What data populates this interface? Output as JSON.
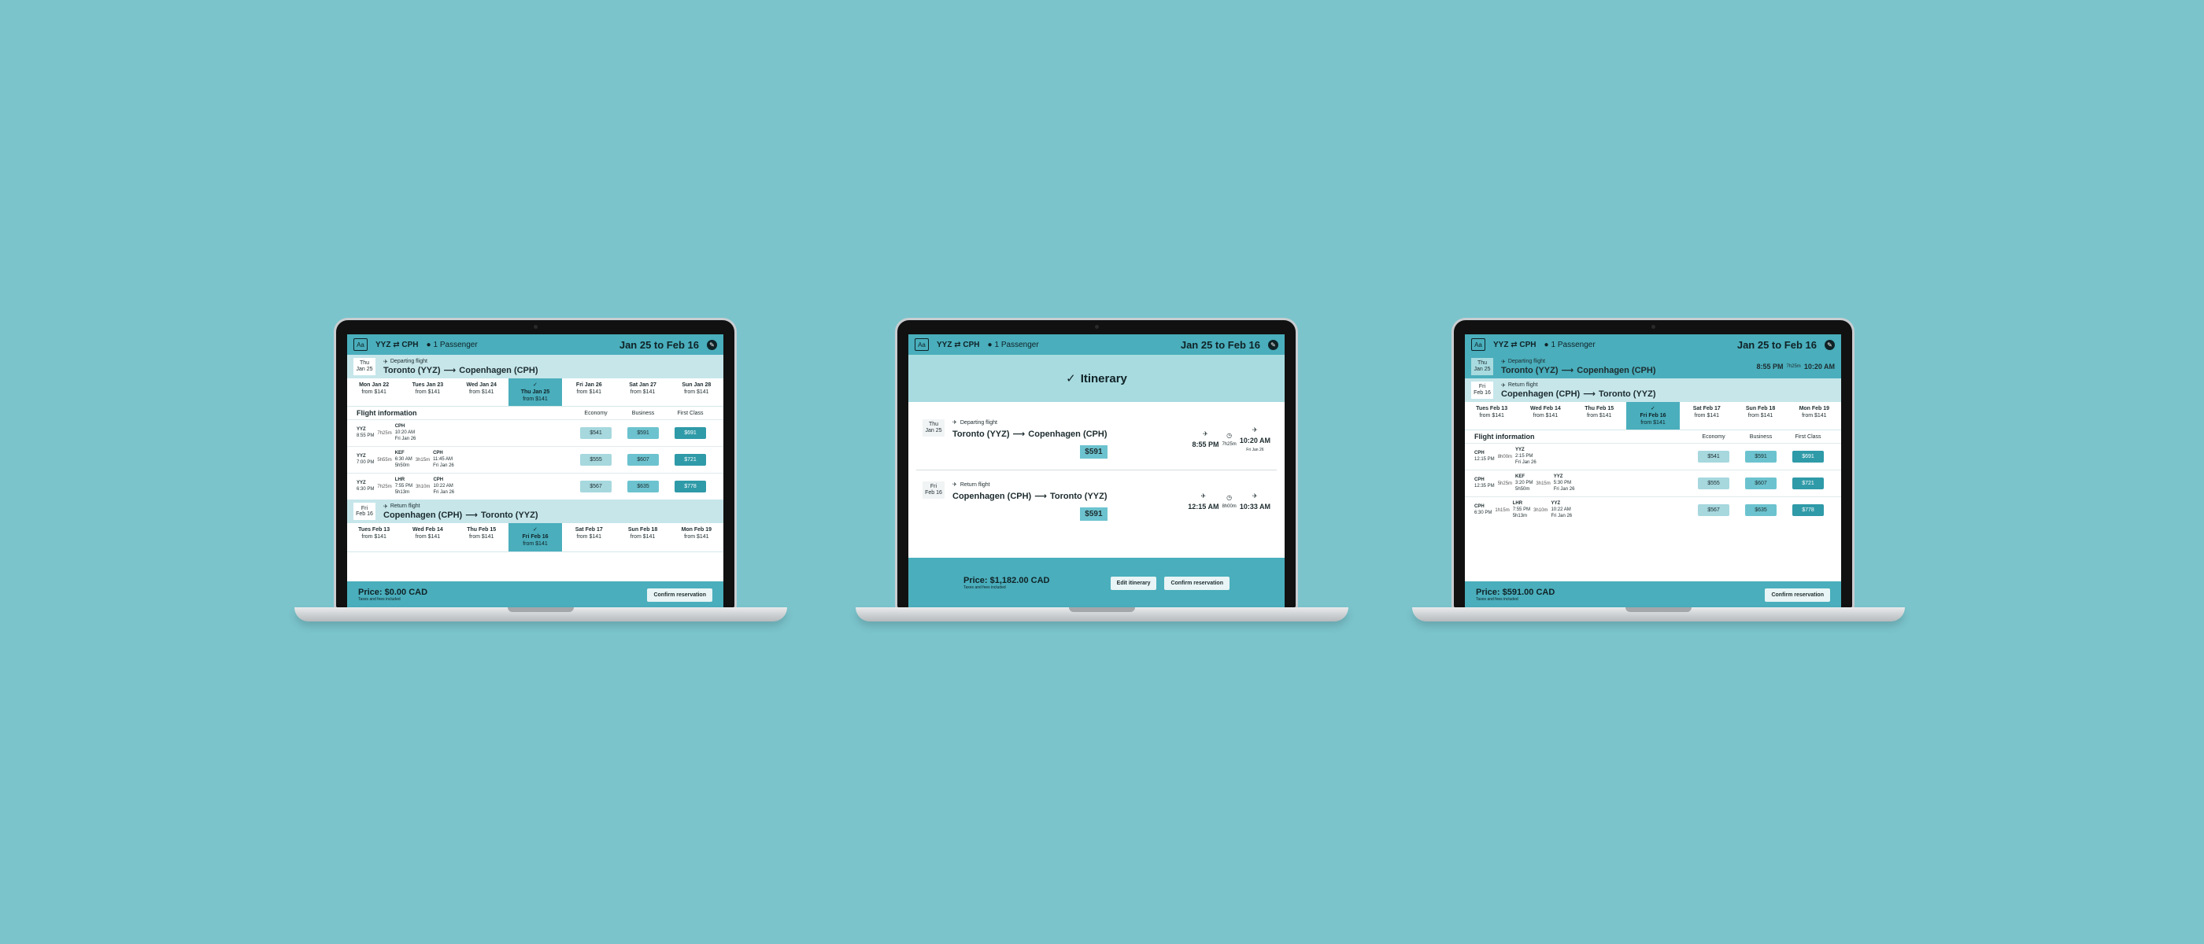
{
  "header": {
    "logo": "Aa",
    "route": "YYZ ⇄ CPH",
    "passengers": "1 Passenger",
    "dates": "Jan 25 to Feb 16"
  },
  "screen1": {
    "depart": {
      "day": "Thu\nJan 25",
      "label": "Departing flight",
      "from": "Toronto (YYZ)",
      "to": "Copenhagen (CPH)"
    },
    "depart_dates": [
      {
        "w": "Mon Jan 22",
        "p": "from $141"
      },
      {
        "w": "Tues Jan 23",
        "p": "from $141"
      },
      {
        "w": "Wed Jan 24",
        "p": "from $141"
      },
      {
        "w": "Thu Jan 25",
        "p": "from $141"
      },
      {
        "w": "Fri Jan 26",
        "p": "from $141"
      },
      {
        "w": "Sat Jan 27",
        "p": "from $141"
      },
      {
        "w": "Sun Jan 28",
        "p": "from $141"
      }
    ],
    "fi": {
      "title": "Flight information",
      "economy": "Economy",
      "business": "Business",
      "first": "First Class"
    },
    "flights": [
      {
        "segs": [
          [
            "YYZ",
            "8:55 PM"
          ],
          [
            "7h25m"
          ],
          [
            "CPH",
            "10:20 AM",
            "Fri Jan 26"
          ]
        ],
        "e": "$541",
        "b": "$591",
        "f": "$691"
      },
      {
        "segs": [
          [
            "YYZ",
            "7:00 PM"
          ],
          [
            "5h55m"
          ],
          [
            "KEF",
            "6:30 AM",
            "5h50m"
          ],
          [
            "3h15m"
          ],
          [
            "CPH",
            "11:45 AM",
            "Fri Jan 26"
          ]
        ],
        "e": "$555",
        "b": "$607",
        "f": "$721"
      },
      {
        "segs": [
          [
            "YYZ",
            "6:30 PM"
          ],
          [
            "7h25m"
          ],
          [
            "LHR",
            "7:55 PM",
            "5h13m"
          ],
          [
            "3h10m"
          ],
          [
            "CPH",
            "10:22 AM",
            "Fri Jan 26"
          ]
        ],
        "e": "$567",
        "b": "$635",
        "f": "$778"
      }
    ],
    "return": {
      "day": "Fri\nFeb 16",
      "label": "Return flight",
      "from": "Copenhagen (CPH)",
      "to": "Toronto (YYZ)"
    },
    "return_dates": [
      {
        "w": "Tues Feb 13",
        "p": "from $141"
      },
      {
        "w": "Wed Feb 14",
        "p": "from $141"
      },
      {
        "w": "Thu Feb 15",
        "p": "from $141"
      },
      {
        "w": "Fri Feb 16",
        "p": "from $141"
      },
      {
        "w": "Sat Feb 17",
        "p": "from $141"
      },
      {
        "w": "Sun Feb 18",
        "p": "from $141"
      },
      {
        "w": "Mon Feb 19",
        "p": "from $141"
      }
    ],
    "price": "Price: $0.00 CAD",
    "note": "Taxes and fees included",
    "confirm": "Confirm reservation"
  },
  "screen2": {
    "title": "Itinerary",
    "depart": {
      "day": "Thu\nJan 25",
      "label": "Departing flight",
      "from": "Toronto (YYZ)",
      "to": "Copenhagen (CPH)",
      "price": "$591",
      "dep": "8:55 PM",
      "dur": "7h25m",
      "arr": "10:20 AM",
      "arrdate": "Fri Jan 26"
    },
    "return": {
      "day": "Fri\nFeb 16",
      "label": "Return flight",
      "from": "Copenhagen (CPH)",
      "to": "Toronto (YYZ)",
      "price": "$591",
      "dep": "12:15 AM",
      "dur": "8h00m",
      "arr": "10:33 AM"
    },
    "price": "Price: $1,182.00 CAD",
    "note": "Taxes and fees included",
    "edit": "Edit itinerary",
    "confirm": "Confirm reservation"
  },
  "screen3": {
    "depart": {
      "day": "Thu\nJan 25",
      "label": "Departing flight",
      "from": "Toronto (YYZ)",
      "to": "Copenhagen (CPH)",
      "dep": "8:55 PM",
      "dur": "7h25m",
      "arr": "10:20 AM"
    },
    "return": {
      "day": "Fri\nFeb 16",
      "label": "Return flight",
      "from": "Copenhagen (CPH)",
      "to": "Toronto (YYZ)"
    },
    "return_dates": [
      {
        "w": "Tues Feb 13",
        "p": "from $141"
      },
      {
        "w": "Wed Feb 14",
        "p": "from $141"
      },
      {
        "w": "Thu Feb 15",
        "p": "from $141"
      },
      {
        "w": "Fri Feb 16",
        "p": "from $141"
      },
      {
        "w": "Sat Feb 17",
        "p": "from $141"
      },
      {
        "w": "Sun Feb 18",
        "p": "from $141"
      },
      {
        "w": "Mon Feb 19",
        "p": "from $141"
      }
    ],
    "fi": {
      "title": "Flight information",
      "economy": "Economy",
      "business": "Business",
      "first": "First Class"
    },
    "flights": [
      {
        "segs": [
          [
            "CPH",
            "12:15 PM"
          ],
          [
            "8h00m"
          ],
          [
            "YYZ",
            "2:15 PM",
            "Fri Jan 26"
          ]
        ],
        "e": "$541",
        "b": "$591",
        "f": "$691"
      },
      {
        "segs": [
          [
            "CPH",
            "12:35 PM"
          ],
          [
            "5h25m"
          ],
          [
            "KEF",
            "3:20 PM",
            "5h50m"
          ],
          [
            "3h15m"
          ],
          [
            "YYZ",
            "5:30 PM",
            "Fri Jan 26"
          ]
        ],
        "e": "$555",
        "b": "$607",
        "f": "$721"
      },
      {
        "segs": [
          [
            "CPH",
            "6:30 PM"
          ],
          [
            "1h15m"
          ],
          [
            "LHR",
            "7:55 PM",
            "5h13m"
          ],
          [
            "3h10m"
          ],
          [
            "YYZ",
            "10:22 AM",
            "Fri Jan 26"
          ]
        ],
        "e": "$567",
        "b": "$635",
        "f": "$778"
      }
    ],
    "price": "Price: $591.00 CAD",
    "note": "Taxes and fees included",
    "confirm": "Confirm reservation"
  }
}
